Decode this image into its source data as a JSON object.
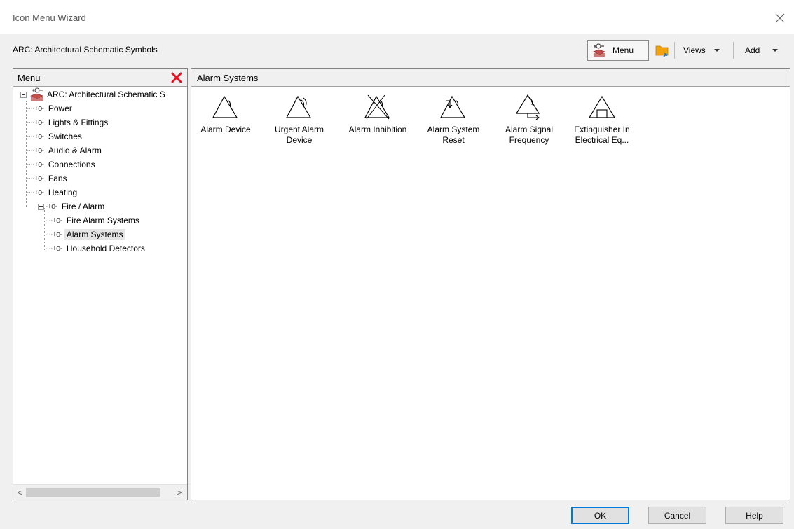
{
  "window": {
    "title": "Icon Menu Wizard"
  },
  "library": {
    "label": "ARC: Architectural Schematic Symbols"
  },
  "toolbar": {
    "menu_label": "Menu",
    "views_label": "Views",
    "add_label": "Add"
  },
  "left_pane": {
    "header": "Menu",
    "tree": [
      {
        "label": "ARC: Architectural Schematic S",
        "level": 0,
        "expanded": true
      },
      {
        "label": "Power",
        "level": 1
      },
      {
        "label": "Lights & Fittings",
        "level": 1
      },
      {
        "label": "Switches",
        "level": 1
      },
      {
        "label": "Audio & Alarm",
        "level": 1
      },
      {
        "label": "Connections",
        "level": 1
      },
      {
        "label": "Fans",
        "level": 1
      },
      {
        "label": "Heating",
        "level": 1
      },
      {
        "label": "Fire / Alarm",
        "level": 1,
        "expanded": true
      },
      {
        "label": "Fire Alarm Systems",
        "level": 2
      },
      {
        "label": "Alarm Systems",
        "level": 2,
        "selected": true
      },
      {
        "label": "Household Detectors",
        "level": 2
      }
    ]
  },
  "right_pane": {
    "header": "Alarm Systems",
    "icons": [
      {
        "line1": "Alarm Device",
        "line2": "",
        "icon": "alarm-device-icon"
      },
      {
        "line1": "Urgent Alarm",
        "line2": "Device",
        "icon": "urgent-alarm-device-icon"
      },
      {
        "line1": "Alarm Inhibition",
        "line2": "",
        "icon": "alarm-inhibition-icon"
      },
      {
        "line1": "Alarm System",
        "line2": "Reset",
        "icon": "alarm-system-reset-icon"
      },
      {
        "line1": "Alarm Signal",
        "line2": "Frequency",
        "icon": "alarm-signal-frequency-icon"
      },
      {
        "line1": "Extinguisher In",
        "line2": "Electrical Eq...",
        "icon": "extinguisher-electrical-icon"
      }
    ]
  },
  "buttons": {
    "ok": "OK",
    "cancel": "Cancel",
    "help": "Help"
  },
  "colors": {
    "close_x": "#e81123",
    "folder": "#f0a30a",
    "folder_arrow": "#1e73be",
    "selected_row": "#e5e5e5"
  }
}
